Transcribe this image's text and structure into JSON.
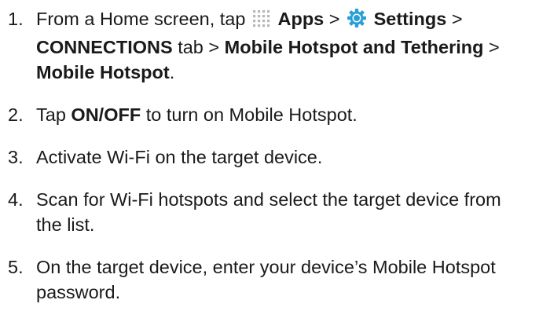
{
  "steps": [
    {
      "number": "1.",
      "text_1": "From a Home screen, tap",
      "apps_icon": "apps-grid-icon",
      "apps": "Apps",
      "sep_1": ">",
      "settings_icon": "settings-gear-icon",
      "settings": "Settings",
      "sep_2": ">",
      "connections": "CONNECTIONS",
      "text_2": "tab >",
      "hotspot_tethering": "Mobile Hotspot and Tethering",
      "sep_3": ">",
      "mobile_hotspot": "Mobile Hotspot",
      "end": "."
    },
    {
      "number": "2.",
      "text_1": "Tap",
      "onoff": "ON/OFF",
      "text_2": "to turn on Mobile Hotspot."
    },
    {
      "number": "3.",
      "text": "Activate Wi-Fi on the target device."
    },
    {
      "number": "4.",
      "text": "Scan for Wi-Fi hotspots and select the target device from the list."
    },
    {
      "number": "5.",
      "text": "On the target device, enter your device’s Mobile Hotspot password."
    }
  ],
  "colors": {
    "text": "#1a1a1a",
    "apps_icon": "#b8b8b8",
    "settings_icon": "#2a9fd6"
  }
}
